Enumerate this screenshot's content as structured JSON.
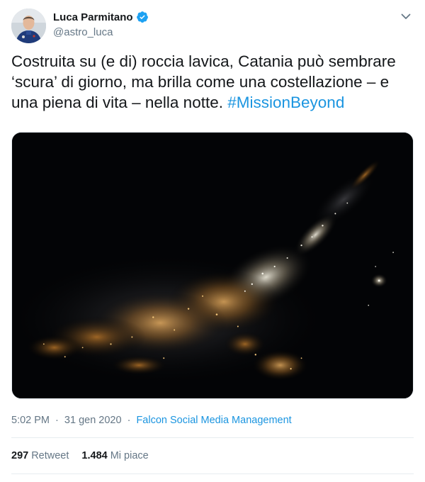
{
  "author": {
    "name": "Luca Parmitano",
    "handle": "@astro_luca"
  },
  "icons": {
    "verified": "verified-badge-icon",
    "menu": "chevron-down-icon"
  },
  "tweet": {
    "text": "Costruita su (e di) roccia lavica, Catania può sembrare ‘scura’ di giorno, ma brilla come una costellazione – e una piena di vita – nella notte. ",
    "hashtag": "#MissionBeyond"
  },
  "meta": {
    "time": "5:02 PM",
    "date": "31 gen 2020",
    "separator": "·",
    "source": "Falcon Social Media Management"
  },
  "stats": {
    "retweets_count": "297",
    "retweets_label": "Retweet",
    "likes_count": "1.484",
    "likes_label": "Mi piace"
  },
  "colors": {
    "link": "#1b95e0",
    "secondary": "#657786",
    "verified": "#1da1f2"
  }
}
